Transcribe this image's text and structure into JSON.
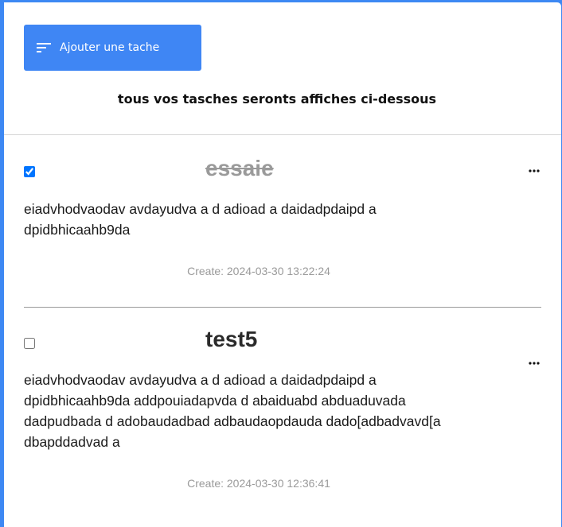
{
  "header": {
    "add_button_label": "Ajouter une tache",
    "subtitle": "tous vos tasches seronts affiches ci-dessous"
  },
  "tasks": [
    {
      "title": "essaie",
      "completed": true,
      "description": "eiadvhodvaodav avdayudva a d adioad a daidadpdaipd a\ndpidbhicaahb9da",
      "created": "Create: 2024-03-30 13:22:24"
    },
    {
      "title": "test5",
      "completed": false,
      "description": "eiadvhodvaodav avdayudva a d adioad a daidadpdaipd a\ndpidbhicaahb9da addpouiadapvda d abaiduabd abduaduvada\ndadpudbada d adobaudadbad adbaudaopdauda dado[adbadvavd[a\ndbapddadvad a",
      "created": "Create: 2024-03-30 12:36:41"
    }
  ],
  "icons": {
    "add_button": "sort-lines-icon",
    "task_menu": "more-horizontal-icon"
  },
  "colors": {
    "background": "#3d88f3",
    "accent": "#3f86f4"
  }
}
